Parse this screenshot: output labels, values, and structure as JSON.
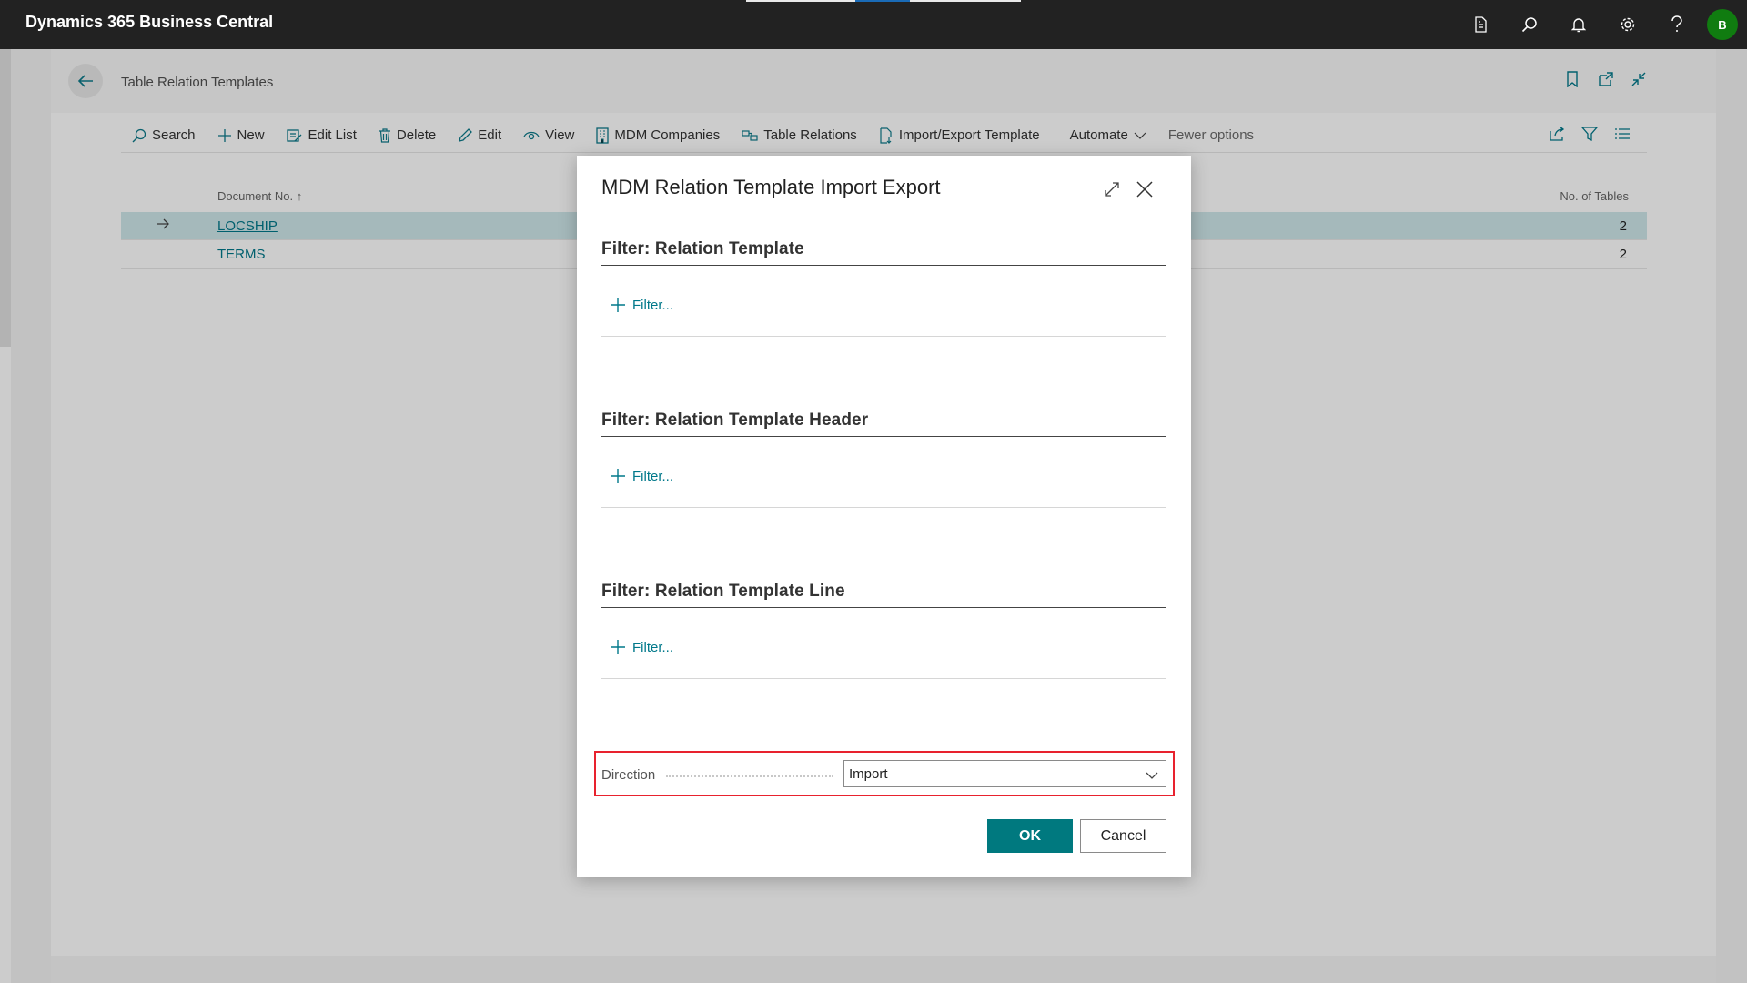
{
  "app": {
    "title": "Dynamics 365 Business Central",
    "avatar_initial": "B"
  },
  "topbar_icons": [
    "document-icon",
    "search-icon",
    "bell-icon",
    "gear-icon",
    "help-icon"
  ],
  "page": {
    "title": "Table Relation Templates",
    "actions": {
      "search": "Search",
      "new": "New",
      "edit_list": "Edit List",
      "delete": "Delete",
      "edit": "Edit",
      "view": "View",
      "mdm_companies": "MDM Companies",
      "table_relations": "Table Relations",
      "import_export_template": "Import/Export Template",
      "automate": "Automate",
      "fewer_options": "Fewer options"
    },
    "columns": {
      "document_no": "Document No. ↑",
      "no_of_tables": "No. of Tables"
    },
    "rows": [
      {
        "document_no": "LOCSHIP",
        "no_of_tables": "2"
      },
      {
        "document_no": "TERMS",
        "no_of_tables": "2"
      }
    ]
  },
  "dialog": {
    "title": "MDM Relation Template Import Export",
    "sections": [
      {
        "title": "Filter: Relation Template",
        "filter_label": "Filter..."
      },
      {
        "title": "Filter: Relation Template Header",
        "filter_label": "Filter..."
      },
      {
        "title": "Filter: Relation Template Line",
        "filter_label": "Filter..."
      }
    ],
    "direction": {
      "label": "Direction",
      "value": "Import"
    },
    "ok_label": "OK",
    "cancel_label": "Cancel"
  },
  "colors": {
    "accent": "#00797f",
    "link": "#00788a",
    "highlight": "#e8222e",
    "selected_row": "#cfe8ea"
  }
}
